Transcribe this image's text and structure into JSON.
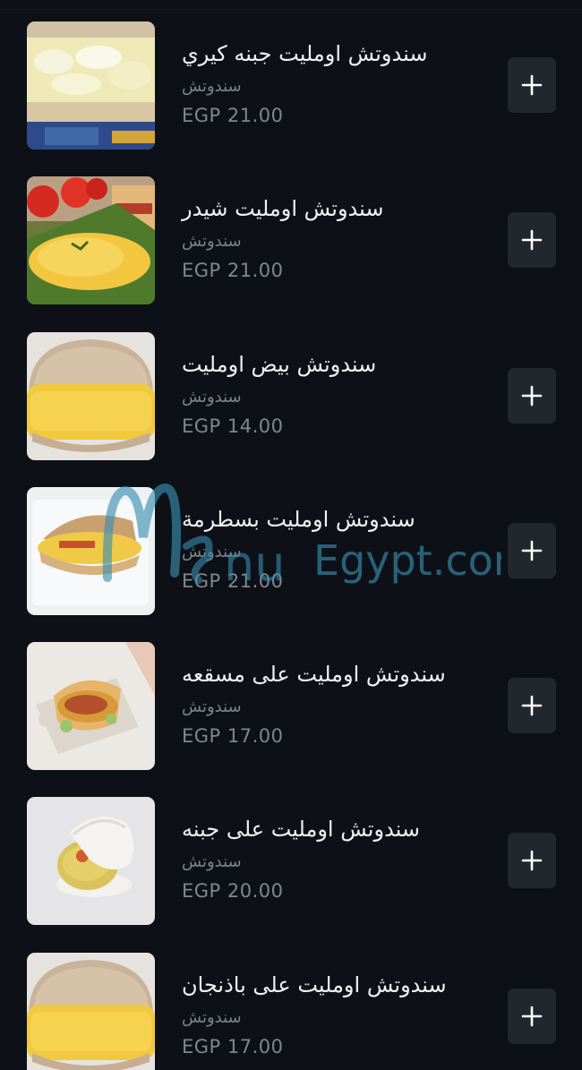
{
  "items": [
    {
      "title": "سندوتش اومليت جبنه كيري",
      "category": "سندوتش",
      "price": "EGP 21.00",
      "image": "omelette-cheese-sandwich-photo"
    },
    {
      "title": "سندوتش اومليت شيدر",
      "category": "سندوتش",
      "price": "EGP 21.00",
      "image": "omelette-cheddar-plate-photo"
    },
    {
      "title": "سندوتش بيض اومليت",
      "category": "سندوتش",
      "price": "EGP 14.00",
      "image": "egg-omelette-sandwich-photo"
    },
    {
      "title": "سندوتش اومليت بسطرمة",
      "category": "سندوتش",
      "price": "EGP 21.00",
      "image": "omelette-basterma-sandwich-photo"
    },
    {
      "title": "سندوتش اومليت على مسقعه",
      "category": "سندوتش",
      "price": "EGP 17.00",
      "image": "omelette-moussaka-sandwich-photo"
    },
    {
      "title": "سندوتش اومليت على جبنه",
      "category": "سندوتش",
      "price": "EGP 20.00",
      "image": "omelette-cheese-bun-photo"
    },
    {
      "title": "سندوتش اومليت على باذنجان",
      "category": "سندوتش",
      "price": "EGP 17.00",
      "image": "omelette-eggplant-sandwich-photo"
    }
  ],
  "add_icon": "plus-icon",
  "watermark": "MenuEgypt.com",
  "colors": {
    "background": "#0d1117",
    "button": "#22272e",
    "title": "#eef0f2",
    "muted": "#7d838b",
    "watermark": "#3a8fb0"
  }
}
